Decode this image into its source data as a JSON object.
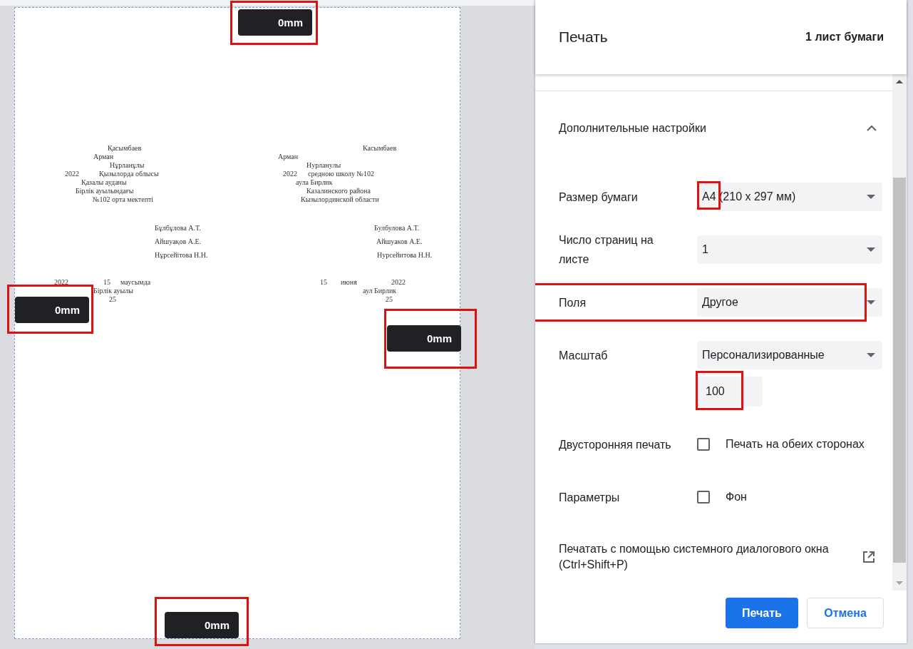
{
  "preview": {
    "doc_lines": [
      {
        "text": "Қасымбаев"
      },
      {
        "text": "Арман"
      },
      {
        "text": "Нұрланұлы"
      },
      {
        "text": "2022"
      },
      {
        "text": "Қызылорда облысы"
      },
      {
        "text": "Қазалы ауданы"
      },
      {
        "text": "Бірлік ауылындағы"
      },
      {
        "text": "№102 орта мектепті"
      },
      {
        "text": "Бұлбұлова А.Т."
      },
      {
        "text": "Айшуақов А.Е."
      },
      {
        "text": "Нұрсейітова Н.Н."
      },
      {
        "text": "2022"
      },
      {
        "text": "15"
      },
      {
        "text": "маусымда"
      },
      {
        "text": "Бірлік ауылы"
      },
      {
        "text": "25"
      },
      {
        "text": "Касымбаев"
      },
      {
        "text": "Арман"
      },
      {
        "text": "Нурланулы"
      },
      {
        "text": "2022"
      },
      {
        "text": "средною школу №102"
      },
      {
        "text": "аула Бирлик"
      },
      {
        "text": "Казалинского района"
      },
      {
        "text": "Кызылординской области"
      },
      {
        "text": "Булбулова А.Т."
      },
      {
        "text": "Айшуаков А.Е."
      },
      {
        "text": "Нурсейитова Н.Н."
      },
      {
        "text": "15"
      },
      {
        "text": "июня"
      },
      {
        "text": "2022"
      },
      {
        "text": "аул Бирлик"
      },
      {
        "text": "25"
      }
    ],
    "margins": [
      {
        "value": "0mm",
        "highlighted": true
      },
      {
        "value": "0mm",
        "highlighted": true
      },
      {
        "value": "0mm",
        "highlighted": true
      },
      {
        "value": "0mm",
        "highlighted": true
      }
    ]
  },
  "panel": {
    "title": "Печать",
    "sheet_count": "1 лист бумаги",
    "section": {
      "title": "Дополнительные настройки",
      "expanded": true
    },
    "settings": [
      {
        "kind": "select",
        "label": "Размер бумаги",
        "value": "A4 (210 x 297 мм)",
        "highlighted": true
      },
      {
        "kind": "select",
        "label": "Число страниц на листе",
        "value": "1",
        "highlighted": false
      },
      {
        "kind": "select",
        "label": "Поля",
        "value": "Другое",
        "highlighted": true
      },
      {
        "kind": "select_input",
        "label": "Масштаб",
        "value": "Персонализированные",
        "input": "100",
        "highlighted": true
      },
      {
        "kind": "checkbox",
        "label": "Двусторонняя печать",
        "option": "Печать на обеих сторонах",
        "checked": false,
        "highlighted": false
      },
      {
        "kind": "checkbox",
        "label": "Параметры",
        "option": "Фон",
        "checked": false,
        "highlighted": false
      },
      {
        "kind": "link",
        "label": "Печатать с помощью системного диалогового окна (Ctrl+Shift+P)",
        "highlighted": false
      }
    ],
    "buttons": [
      {
        "label": "Печать",
        "kind": "primary"
      },
      {
        "label": "Отмена",
        "kind": "secondary"
      }
    ]
  }
}
